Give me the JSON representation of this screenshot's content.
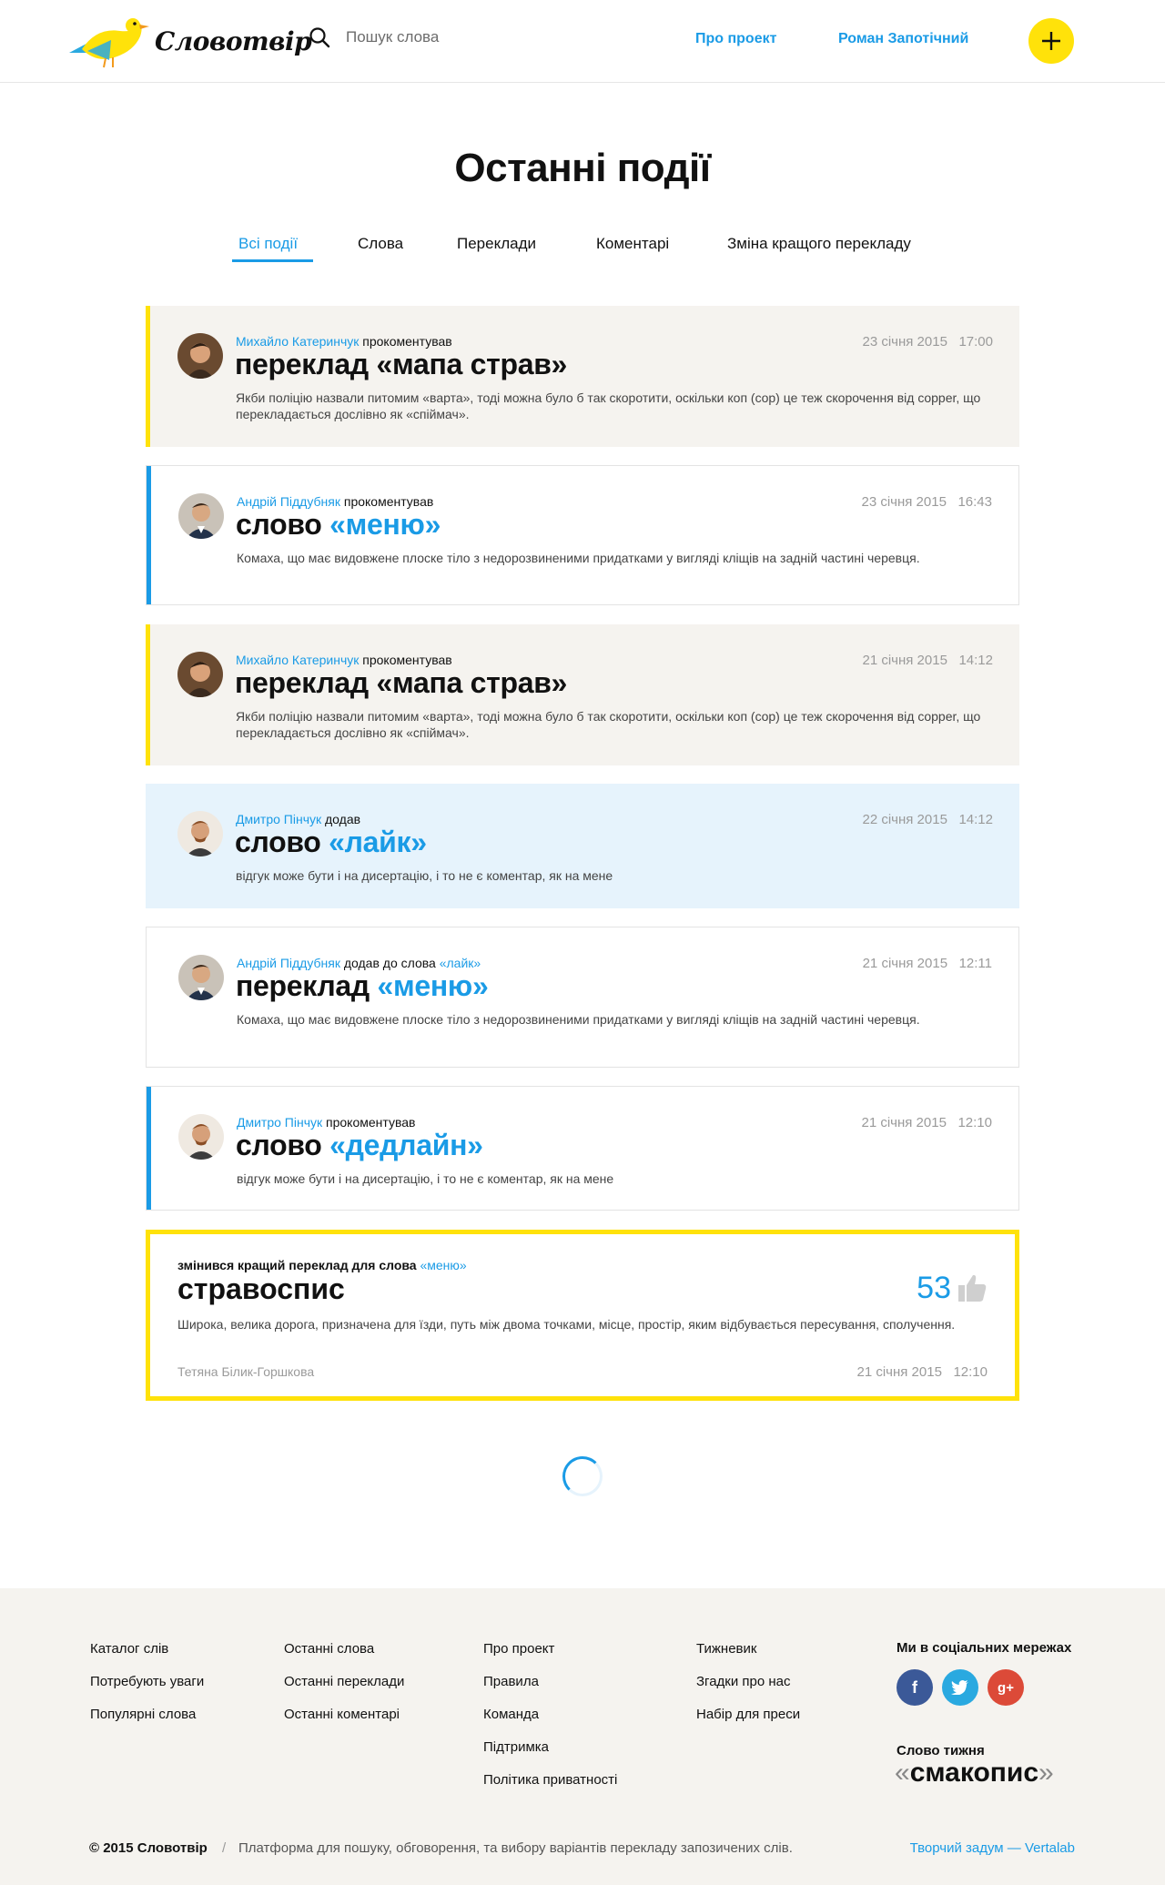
{
  "header": {
    "logo_text": "Словотвір",
    "search_placeholder": "Пошук слова",
    "nav_about": "Про проект",
    "nav_user": "Роман Запотічний"
  },
  "page_title": "Останні події",
  "tabs": [
    {
      "label": "Всі події",
      "active": true
    },
    {
      "label": "Слова"
    },
    {
      "label": "Переклади"
    },
    {
      "label": "Коментарі"
    },
    {
      "label": "Зміна кращого перекладу"
    }
  ],
  "events": [
    {
      "user": "Михайло Катеринчук",
      "action": "прокоментував",
      "date": "23 січня 2015",
      "time": "17:00",
      "title_prefix": "переклад",
      "title_word": "«мапа страв»",
      "text": "Якби поліцію назвали питомим «варта», тоді можна було б так скоротити, оскільки коп (cop) це теж скорочення від copper, що перекладається дослівно як «спіймач»."
    },
    {
      "user": "Андрій Піддубняк",
      "action": "прокоментував",
      "date": "23 січня 2015",
      "time": "16:43",
      "title_prefix": "слово",
      "title_word": "«меню»",
      "text": "Комаха, що має видовжене плоске тіло з недорозвиненими придатками у вигляді кліщів на задній частині черевця."
    },
    {
      "user": "Михайло Катеринчук",
      "action": "прокоментував",
      "date": "21 січня 2015",
      "time": "14:12",
      "title_prefix": "переклад",
      "title_word": "«мапа страв»",
      "text": "Якби поліцію назвали питомим «варта», тоді можна було б так скоротити, оскільки коп (cop) це теж скорочення від copper, що перекладається дослівно як «спіймач»."
    },
    {
      "user": "Дмитро Пінчук",
      "action": "додав",
      "date": "22 січня 2015",
      "time": "14:12",
      "title_prefix": "слово",
      "title_word": "«лайк»",
      "text": "відгук може бути і на дисертацію, і то не є коментар, як на мене"
    },
    {
      "user": "Андрій Піддубняк",
      "action": "додав до слова",
      "action_word": "«лайк»",
      "date": "21 січня 2015",
      "time": "12:11",
      "title_prefix": "переклад",
      "title_word": "«меню»",
      "text": "Комаха, що має видовжене плоске тіло з недорозвиненими придатками у вигляді кліщів на задній частині черевця."
    },
    {
      "user": "Дмитро Пінчук",
      "action": "прокоментував",
      "date": "21 січня 2015",
      "time": "12:10",
      "title_prefix": "слово",
      "title_word": "«дедлайн»",
      "text": "відгук може бути і на дисертацію, і то не є коментар, як на мене"
    }
  ],
  "best_translation": {
    "meta": "змінився кращий переклад для слова",
    "meta_word": "«меню»",
    "title": "стравоспис",
    "text": "Широка, велика дорога, призначена для їзди, путь між двома точками, місце, простір, яким відбувається пересування, сполучення.",
    "votes": "53",
    "author": "Тетяна Білик-Горшкова",
    "date": "21 січня 2015",
    "time": "12:10"
  },
  "footer": {
    "col1": [
      "Каталог слів",
      "Потребують уваги",
      "Популярні слова"
    ],
    "col2": [
      "Останні слова",
      "Останні переклади",
      "Останні коментарі"
    ],
    "col3": [
      "Про проект",
      "Правила",
      "Команда",
      "Підтримка",
      "Політика приватності"
    ],
    "col4": [
      "Тижневик",
      "Згадки про нас",
      "Набір для преси"
    ],
    "social_title": "Ми в соціальних мережах",
    "social": [
      "facebook",
      "twitter",
      "google-plus"
    ],
    "word_of_week_label": "Слово тижня",
    "word_of_week": "смакопис",
    "copyright": "© 2015 Словотвір",
    "separator": "/",
    "description": "Платформа для пошуку, обговорення, та вибору варіантів перекладу запозичених слів.",
    "credit": "Творчий задум — Vertalab"
  },
  "colors": {
    "accent": "#1a9be6",
    "highlight": "#ffe20a",
    "beige": "#f5f3ef",
    "light_blue": "#e6f3fc"
  }
}
